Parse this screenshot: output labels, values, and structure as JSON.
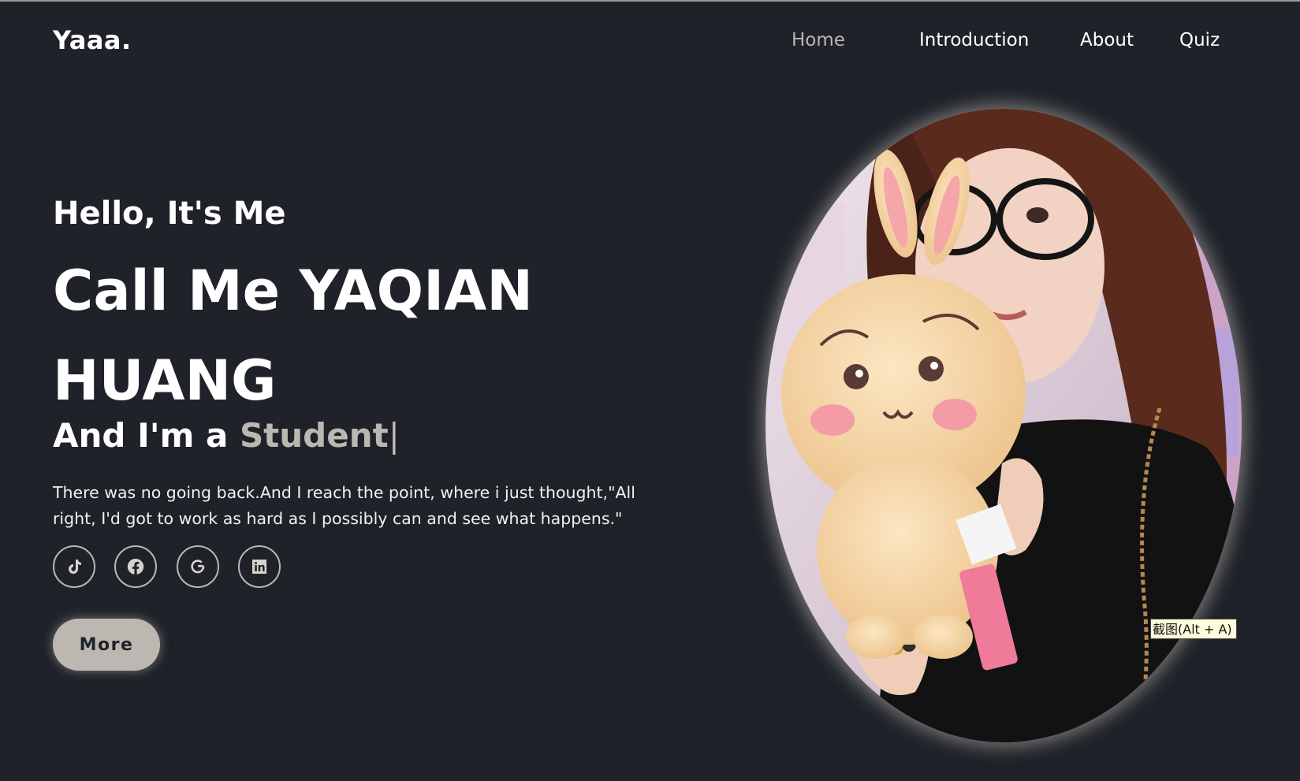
{
  "header": {
    "logo": "Yaaa.",
    "nav": [
      {
        "label": "Home",
        "active": true
      },
      {
        "label": "Introduction",
        "active": false
      },
      {
        "label": "About",
        "active": false
      },
      {
        "label": "Quiz",
        "active": false
      }
    ]
  },
  "hero": {
    "greeting": "Hello, It's Me",
    "name": "Call Me YAQIAN HUANG",
    "role_prefix": "And I'm a ",
    "role_highlight": "Student",
    "cursor": "|",
    "description": "There was no going back.And I reach the point, where i just thought,\"All right, I'd got to work as hard as I possibly can and see what happens.\"",
    "socials": [
      {
        "icon": "tiktok-icon"
      },
      {
        "icon": "facebook-icon"
      },
      {
        "icon": "google-icon"
      },
      {
        "icon": "linkedin-icon"
      }
    ],
    "more_label": "More"
  },
  "tooltip": {
    "text": "截图(Alt + A)"
  },
  "colors": {
    "background": "#1f2229",
    "accent": "#bcb8b1",
    "text": "#ffffff"
  }
}
